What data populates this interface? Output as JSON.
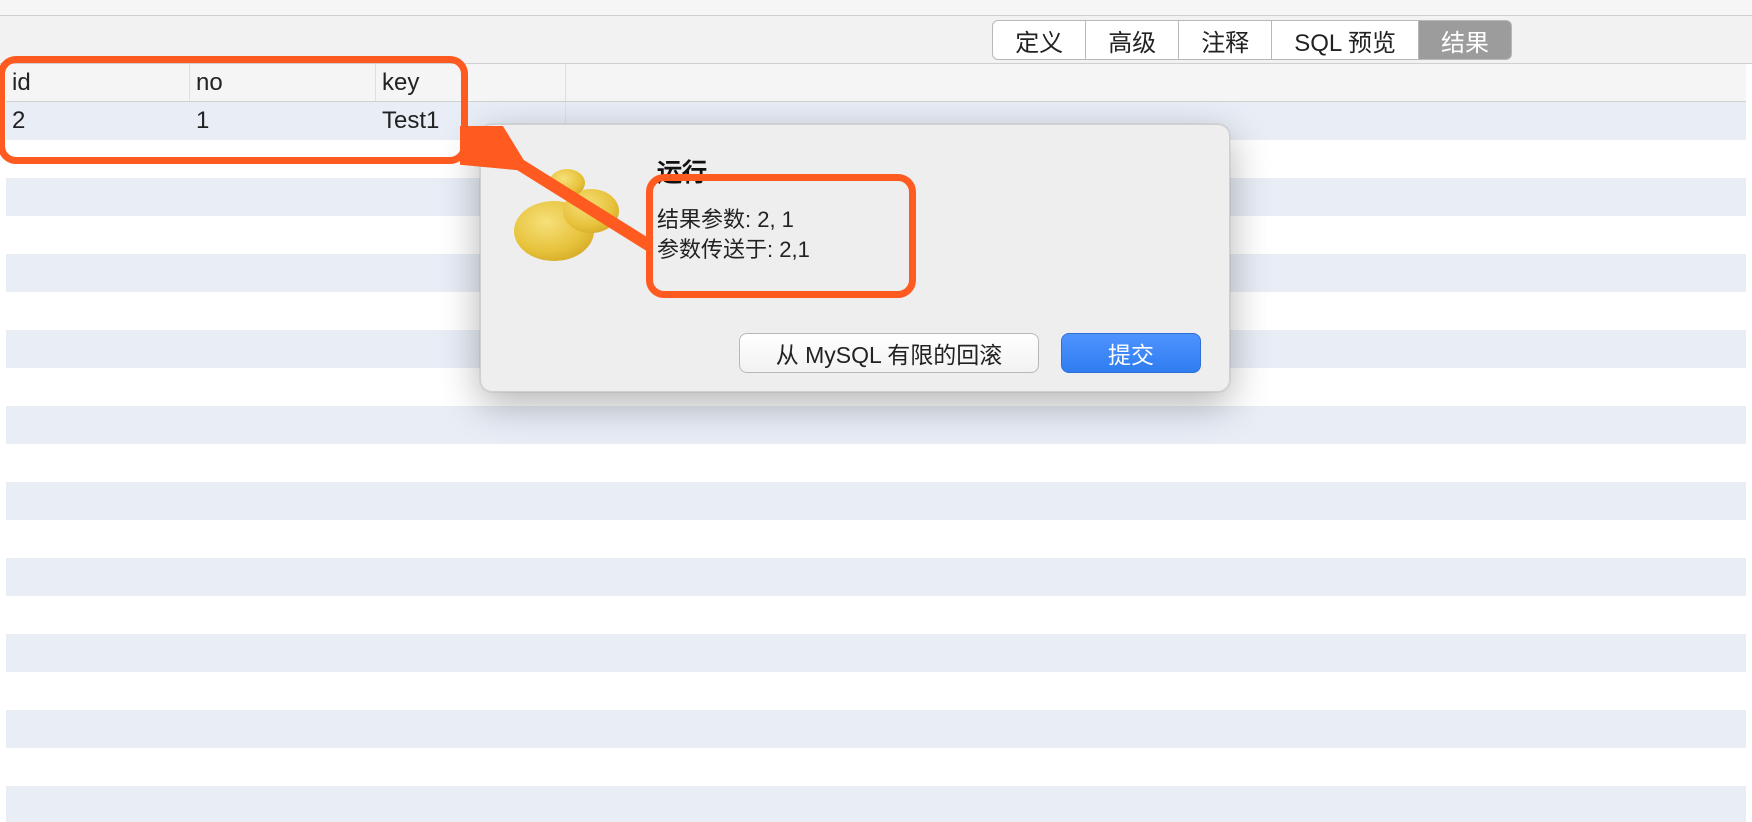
{
  "tabs": {
    "definition": "定义",
    "advanced": "高级",
    "comment": "注释",
    "sql_preview": "SQL 预览",
    "result": "结果"
  },
  "table": {
    "headers": {
      "id": "id",
      "no": "no",
      "key": "key"
    },
    "row": {
      "id": "2",
      "no": "1",
      "key": "Test1"
    }
  },
  "dialog": {
    "title": "运行",
    "line1": "结果参数: 2, 1",
    "line2": "参数传送于: 2,1",
    "rollback_btn": "从 MySQL 有限的回滚",
    "submit_btn": "提交"
  }
}
